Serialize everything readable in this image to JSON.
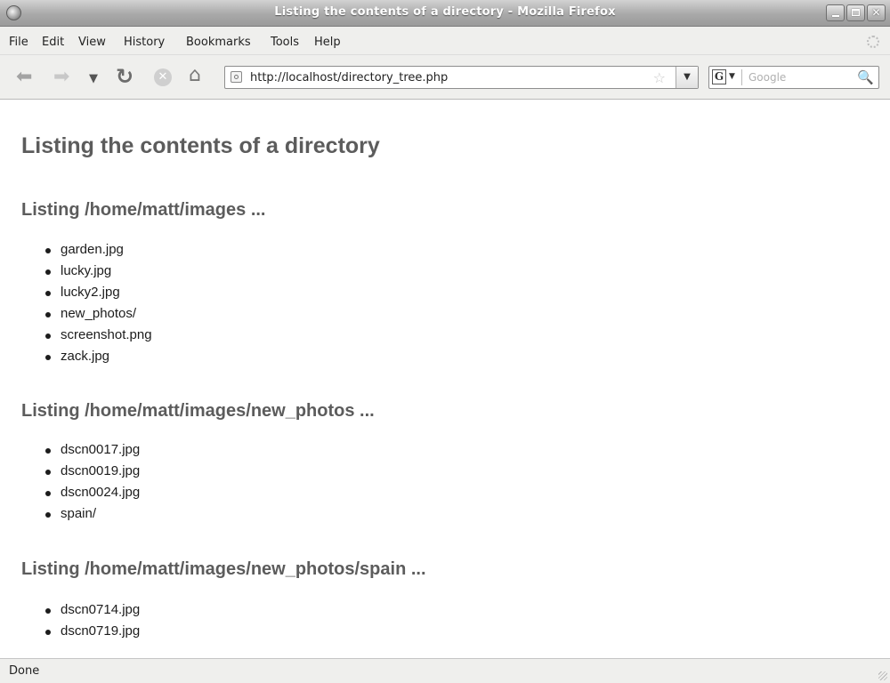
{
  "window": {
    "title": "Listing the contents of a directory - Mozilla Firefox"
  },
  "menu": {
    "items": [
      "File",
      "Edit",
      "View",
      "History",
      "Bookmarks",
      "Tools",
      "Help"
    ]
  },
  "toolbar": {
    "url": "http://localhost/directory_tree.php",
    "search_placeholder": "Google",
    "search_engine_glyph": "G",
    "icons": [
      "back-icon",
      "forward-icon",
      "history-dropdown-icon",
      "reload-icon",
      "stop-icon",
      "home-icon",
      "bookmark-star-icon",
      "search-icon"
    ]
  },
  "page": {
    "heading": "Listing the contents of a directory",
    "sections": [
      {
        "title": "Listing /home/matt/images ...",
        "items": [
          "garden.jpg",
          "lucky.jpg",
          "lucky2.jpg",
          "new_photos/",
          "screenshot.png",
          "zack.jpg"
        ]
      },
      {
        "title": "Listing /home/matt/images/new_photos ...",
        "items": [
          "dscn0017.jpg",
          "dscn0019.jpg",
          "dscn0024.jpg",
          "spain/"
        ]
      },
      {
        "title": "Listing /home/matt/images/new_photos/spain ...",
        "items": [
          "dscn0714.jpg",
          "dscn0719.jpg"
        ]
      }
    ]
  },
  "status": {
    "text": "Done"
  }
}
